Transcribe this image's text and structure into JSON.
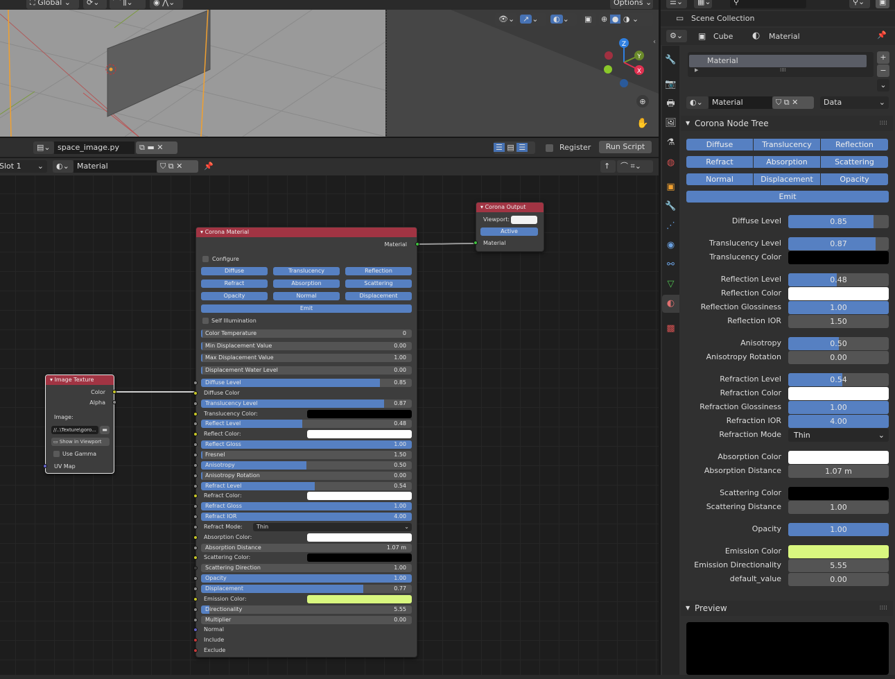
{
  "viewport": {
    "orientation": "Global",
    "options_label": "Options",
    "gizmo_axes": [
      "Z",
      "Y",
      "X"
    ]
  },
  "text_editor": {
    "filename": "space_image.py",
    "register_label": "Register",
    "run_script_label": "Run Script"
  },
  "node_editor": {
    "slot": "Slot 1",
    "material": "Material"
  },
  "nodes": {
    "corona_output": {
      "title": "Corona Output",
      "viewport_label": "Viewport:",
      "viewport_color": "#f2f2f2",
      "active_label": "Active",
      "material_socket": "Material"
    },
    "image_texture": {
      "title": "Image Texture",
      "color_socket": "Color",
      "alpha_socket": "Alpha",
      "image_label": "Image:",
      "image_path": "//..\\Texture\\goro...",
      "show_in_viewport": "Show in Viewport",
      "use_gamma": "Use Gamma",
      "uv_map": "UV Map"
    },
    "corona_material": {
      "title": "Corona Material",
      "output_socket": "Material",
      "configure": "Configure",
      "buttons": [
        "Diffuse",
        "Translucency",
        "Reflection",
        "Refract",
        "Absorption",
        "Scattering",
        "Opacity",
        "Normal",
        "Displacement"
      ],
      "emit": "Emit",
      "self_illumination": "Self Illumination",
      "params": [
        {
          "label": "Color Temperature",
          "value": "0",
          "fill": 0
        },
        {
          "label": "Min Displacement Value",
          "value": "0.00",
          "fill": 0
        },
        {
          "label": "Max Displacement Value",
          "value": "1.00",
          "fill": 0
        },
        {
          "label": "Displacement Water Level",
          "value": "0.00",
          "fill": 0
        }
      ],
      "inputs": [
        {
          "type": "slider",
          "label": "Diffuse Level",
          "value": "0.85",
          "fill": 0.85,
          "socket": "#8a8a8a"
        },
        {
          "type": "label",
          "label": "Diffuse Color",
          "socket": "#c7c729"
        },
        {
          "type": "slider",
          "label": "Translucency Level",
          "value": "0.87",
          "fill": 0.87,
          "socket": "#8a8a8a"
        },
        {
          "type": "color",
          "label": "Translucency Color:",
          "color": "#000000",
          "socket": "#c7c729"
        },
        {
          "type": "slider",
          "label": "Reflect Level",
          "value": "0.48",
          "fill": 0.48,
          "socket": "#8a8a8a"
        },
        {
          "type": "color",
          "label": "Reflect Color:",
          "color": "#ffffff",
          "socket": "#c7c729"
        },
        {
          "type": "slider",
          "label": "Reflect Gloss",
          "value": "1.00",
          "fill": 1,
          "socket": "#8a8a8a"
        },
        {
          "type": "slider",
          "label": "Fresnel",
          "value": "1.50",
          "fill": 0.005,
          "socket": "#8a8a8a"
        },
        {
          "type": "slider",
          "label": "Anisotropy",
          "value": "0.50",
          "fill": 0.5,
          "socket": "#8a8a8a"
        },
        {
          "type": "slider",
          "label": "Anisotropy Rotation",
          "value": "0.00",
          "fill": 0.005,
          "socket": "#8a8a8a"
        },
        {
          "type": "slider",
          "label": "Refract Level",
          "value": "0.54",
          "fill": 0.54,
          "socket": "#8a8a8a"
        },
        {
          "type": "color",
          "label": "Refract Color:",
          "color": "#ffffff",
          "socket": "#c7c729"
        },
        {
          "type": "slider",
          "label": "Refract Gloss",
          "value": "1.00",
          "fill": 1,
          "socket": "#8a8a8a"
        },
        {
          "type": "slider",
          "label": "Refract IOR",
          "value": "4.00",
          "fill": 1,
          "socket": "#8a8a8a"
        },
        {
          "type": "select",
          "label": "Refract Mode:",
          "value": "Thin",
          "socket": "#8a8a8a"
        },
        {
          "type": "color",
          "label": "Absorption Color:",
          "color": "#ffffff",
          "socket": "#c7c729"
        },
        {
          "type": "slider",
          "label": "Absorption Distance",
          "value": "1.07 m",
          "fill": 0,
          "socket": "#8a8a8a"
        },
        {
          "type": "color",
          "label": "Scattering Color:",
          "color": "#000000",
          "socket": "#c7c729"
        },
        {
          "type": "slider",
          "label": "Scattering Direction",
          "value": "1.00",
          "fill": 0,
          "socket": "#3d3d3d"
        },
        {
          "type": "slider",
          "label": "Opacity",
          "value": "1.00",
          "fill": 1,
          "socket": "#8a8a8a"
        },
        {
          "type": "slider",
          "label": "Displacement",
          "value": "0.77",
          "fill": 0.77,
          "socket": "#8a8a8a"
        },
        {
          "type": "color",
          "label": "Emission Color:",
          "color": "#d9f77f",
          "socket": "#c7c729"
        },
        {
          "type": "slider",
          "label": "Directionality",
          "value": "5.55",
          "fill": 0.04,
          "socket": "#8a8a8a"
        },
        {
          "type": "slider",
          "label": "Multiplier",
          "value": "0.00",
          "fill": 0,
          "socket": "#8a8a8a"
        },
        {
          "type": "label",
          "label": "Normal",
          "socket": "#6363c7"
        },
        {
          "type": "label",
          "label": "Include",
          "socket": "#c73a3a"
        },
        {
          "type": "label",
          "label": "Exclude",
          "socket": "#c73a3a"
        }
      ]
    }
  },
  "properties": {
    "outliner_title": "Scene Collection",
    "breadcrumb": {
      "object": "Cube",
      "material": "Material"
    },
    "slot_list": [
      "Material"
    ],
    "material_name": "Material",
    "link_mode": "Data",
    "panel_title": "Corona Node Tree",
    "buttons": [
      "Diffuse",
      "Translucency",
      "Reflection",
      "Refract",
      "Absorption",
      "Scattering",
      "Normal",
      "Displacement",
      "Opacity"
    ],
    "emit": "Emit",
    "groups": [
      [
        {
          "label": "Diffuse Level",
          "value": "0.85",
          "fill": 0.85
        }
      ],
      [
        {
          "label": "Translucency Level",
          "value": "0.87",
          "fill": 0.87
        },
        {
          "label": "Translucency Color",
          "color": "#000000"
        }
      ],
      [
        {
          "label": "Reflection Level",
          "value": "0.48",
          "fill": 0.48
        },
        {
          "label": "Reflection Color",
          "color": "#ffffff"
        },
        {
          "label": "Reflection Glossiness",
          "value": "1.00",
          "fill": 1
        },
        {
          "label": "Reflection IOR",
          "value": "1.50",
          "fill": 0
        }
      ],
      [
        {
          "label": "Anisotropy",
          "value": "0.50",
          "fill": 0.5
        },
        {
          "label": "Anisotropy Rotation",
          "value": "0.00",
          "fill": 0
        }
      ],
      [
        {
          "label": "Refraction Level",
          "value": "0.54",
          "fill": 0.54
        },
        {
          "label": "Refraction Color",
          "color": "#ffffff"
        },
        {
          "label": "Refraction Glossiness",
          "value": "1.00",
          "fill": 1
        },
        {
          "label": "Refraction IOR",
          "value": "4.00",
          "fill": 1
        },
        {
          "label": "Refraction Mode",
          "select": "Thin"
        }
      ],
      [
        {
          "label": "Absorption Color",
          "color": "#ffffff"
        },
        {
          "label": "Absorption Distance",
          "value": "1.07 m",
          "fill": 0
        }
      ],
      [
        {
          "label": "Scattering Color",
          "color": "#000000"
        },
        {
          "label": "Scattering Distance",
          "value": "1.00",
          "fill": 0
        }
      ],
      [
        {
          "label": "Opacity",
          "value": "1.00",
          "fill": 1
        }
      ],
      [
        {
          "label": "Emission Color",
          "color": "#d9f77f"
        },
        {
          "label": "Emission Directionality",
          "value": "5.55",
          "fill": 0
        },
        {
          "label": "default_value",
          "value": "0.00",
          "fill": 0
        }
      ]
    ],
    "preview_title": "Preview"
  },
  "colors": {
    "accent": "#5680c2",
    "node_header": "#a13443",
    "emission": "#d9f77f"
  }
}
